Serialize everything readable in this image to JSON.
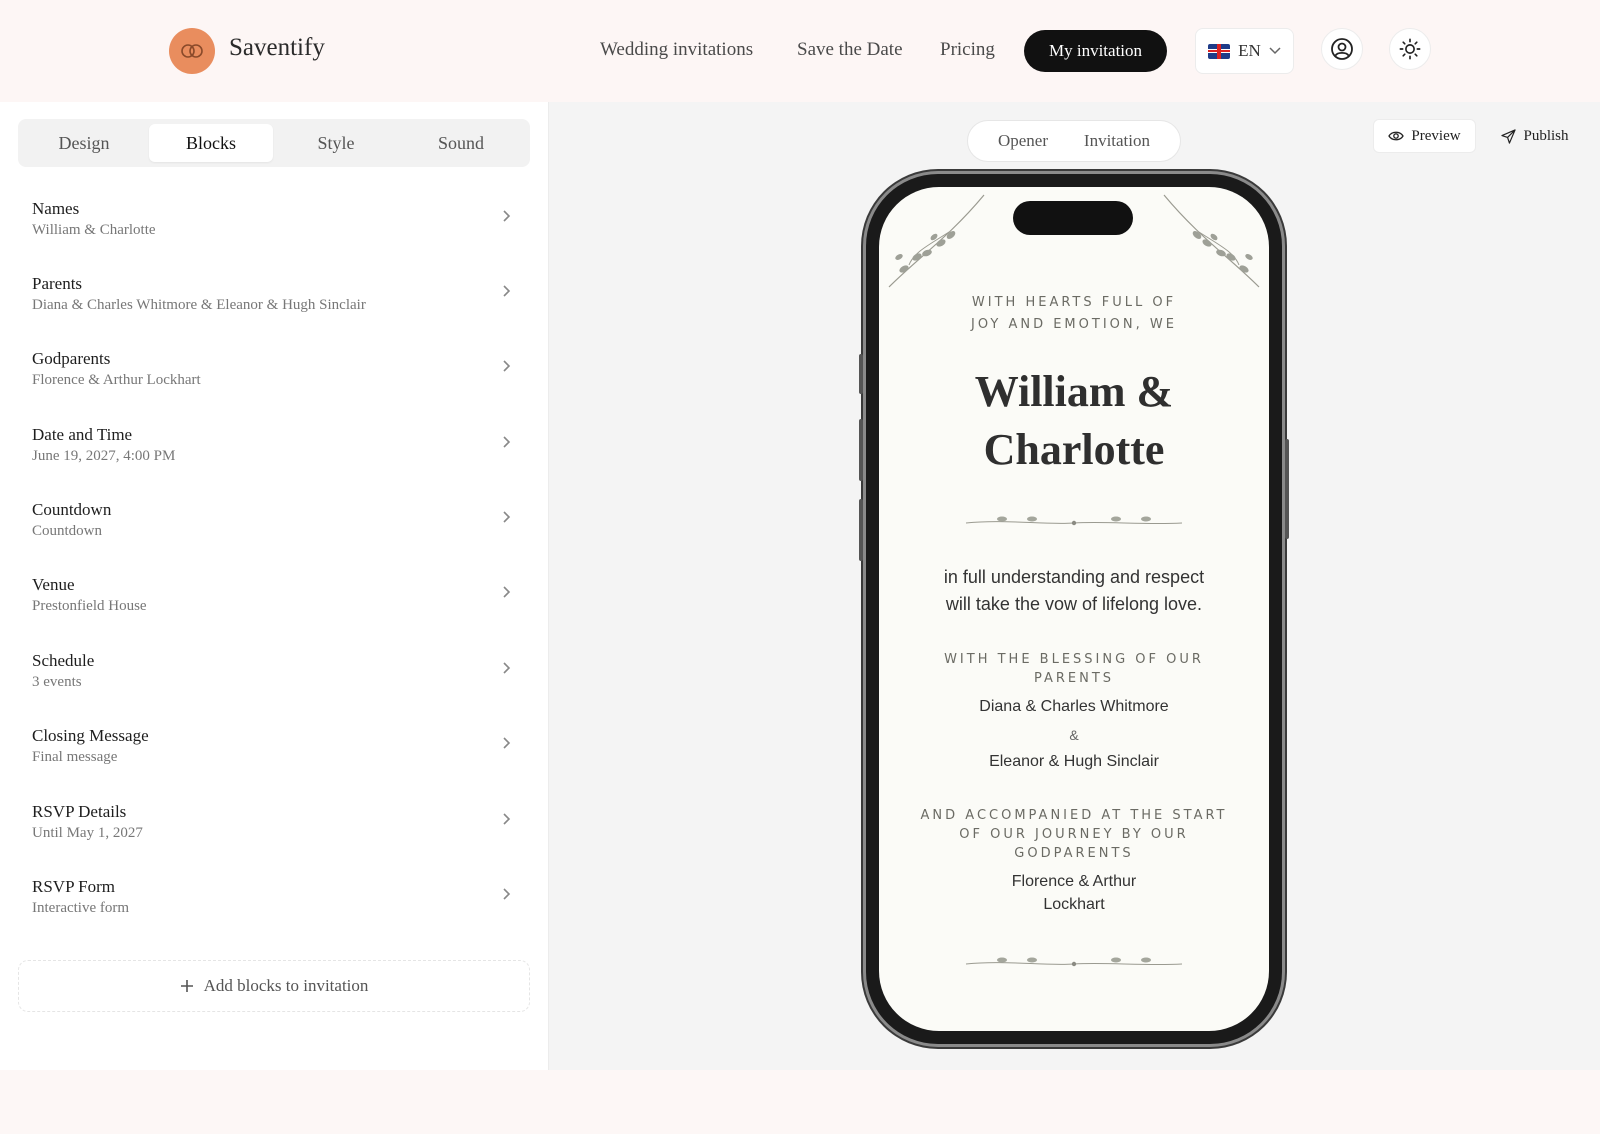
{
  "header": {
    "brand": "Saventify",
    "nav": [
      "Wedding invitations",
      "Save the Date",
      "Pricing"
    ],
    "cta": "My invitation",
    "lang": "EN"
  },
  "sidebar": {
    "tabs": [
      "Design",
      "Blocks",
      "Style",
      "Sound"
    ],
    "active_tab": "Blocks",
    "items": [
      {
        "title": "Names",
        "sub": "William & Charlotte"
      },
      {
        "title": "Parents",
        "sub": "Diana & Charles Whitmore & Eleanor & Hugh Sinclair"
      },
      {
        "title": "Godparents",
        "sub": "Florence & Arthur Lockhart"
      },
      {
        "title": "Date and Time",
        "sub": "June 19, 2027, 4:00 PM"
      },
      {
        "title": "Countdown",
        "sub": "Countdown"
      },
      {
        "title": "Venue",
        "sub": "Prestonfield House"
      },
      {
        "title": "Schedule",
        "sub": "3 events"
      },
      {
        "title": "Closing Message",
        "sub": "Final message"
      },
      {
        "title": "RSVP Details",
        "sub": "Until May 1, 2027"
      },
      {
        "title": "RSVP Form",
        "sub": "Interactive form"
      }
    ],
    "add_label": "Add blocks to invitation"
  },
  "preview": {
    "segments": [
      "Opener",
      "Invitation"
    ],
    "preview_label": "Preview",
    "publish_label": "Publish"
  },
  "invitation": {
    "intro_line1": "WITH HEARTS FULL OF",
    "intro_line2": "JOY AND EMOTION, WE",
    "names_line1": "William &",
    "names_line2": "Charlotte",
    "vow_line1": "in full understanding and respect",
    "vow_line2": "will take the vow of lifelong love.",
    "blessing_line1": "WITH THE BLESSING OF OUR",
    "blessing_line2": "PARENTS",
    "parents1": "Diana & Charles Whitmore",
    "amp": "&",
    "parents2": "Eleanor & Hugh Sinclair",
    "godparents_line1": "AND ACCOMPANIED AT THE START",
    "godparents_line2": "OF OUR JOURNEY BY OUR",
    "godparents_line3": "GODPARENTS",
    "godparents_name1": "Florence & Arthur",
    "godparents_name2": "Lockhart"
  },
  "colors": {
    "accent": "#e98d5e",
    "cta_bg": "#111111",
    "page_bg": "#fdf7f6",
    "invitation_bg": "#fbfbf7"
  }
}
